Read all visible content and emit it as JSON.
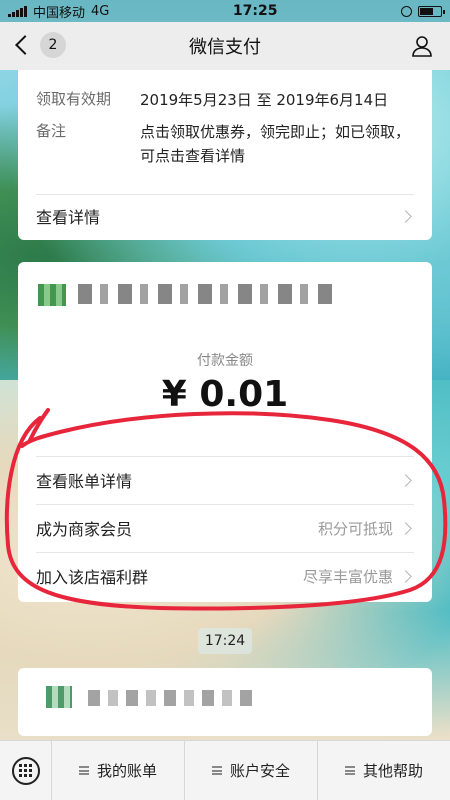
{
  "status_bar": {
    "carrier": "中国移动",
    "network": "4G",
    "time": "17:25"
  },
  "nav": {
    "title": "微信支付",
    "back_badge": "2"
  },
  "coupon_card": {
    "rows": [
      {
        "key": "领取有效期",
        "value": "2019年5月23日 至 2019年6月14日"
      },
      {
        "key": "备注",
        "value": "点击领取优惠券，领完即止；如已领取，可点击查看详情"
      }
    ],
    "details_link": "查看详情"
  },
  "payment_card": {
    "amount_label": "付款金额",
    "amount": "¥ 0.01",
    "rows": [
      {
        "label": "查看账单详情",
        "extra": ""
      },
      {
        "label": "成为商家会员",
        "extra": "积分可抵现"
      },
      {
        "label": "加入该店福利群",
        "extra": "尽享丰富优惠"
      }
    ]
  },
  "time_chip": "17:24",
  "bottom_menu": {
    "items": [
      "我的账单",
      "账户安全",
      "其他帮助"
    ]
  },
  "colors": {
    "annotation": "#e8263b",
    "nav_bg": "#ededed"
  }
}
